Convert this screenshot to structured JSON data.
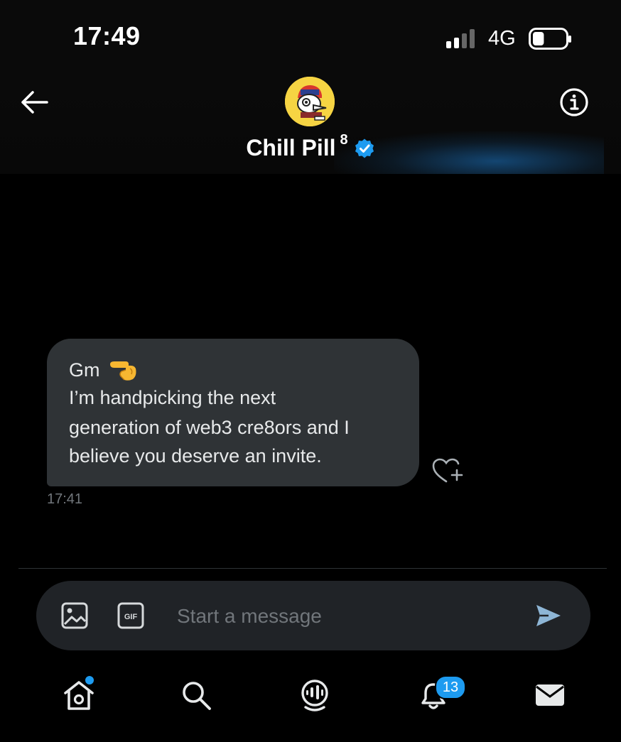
{
  "status": {
    "time": "17:49",
    "network": "4G",
    "battery_level": 0.35
  },
  "header": {
    "name": "Chill Pill",
    "name_suffix": "8",
    "verified": true,
    "back_icon": "arrow-left-icon",
    "info_icon": "info-icon"
  },
  "messages": [
    {
      "lines": [
        "Gm",
        "I’m handpicking the next",
        "generation of web3 cre8ors and I",
        "believe you deserve an invite."
      ],
      "emoji": "backhand-pointing-left",
      "time": "17:41"
    }
  ],
  "composer": {
    "placeholder": "Start a message",
    "value": "",
    "image_icon": "image-icon",
    "gif_icon": "gif-icon",
    "send_icon": "send-icon"
  },
  "tabbar": {
    "items": [
      "home",
      "search",
      "spaces",
      "notifications",
      "messages"
    ],
    "notifications_badge": "13"
  },
  "colors": {
    "accent": "#1d9bf0",
    "bubble": "#2f3336",
    "background": "#000000"
  }
}
